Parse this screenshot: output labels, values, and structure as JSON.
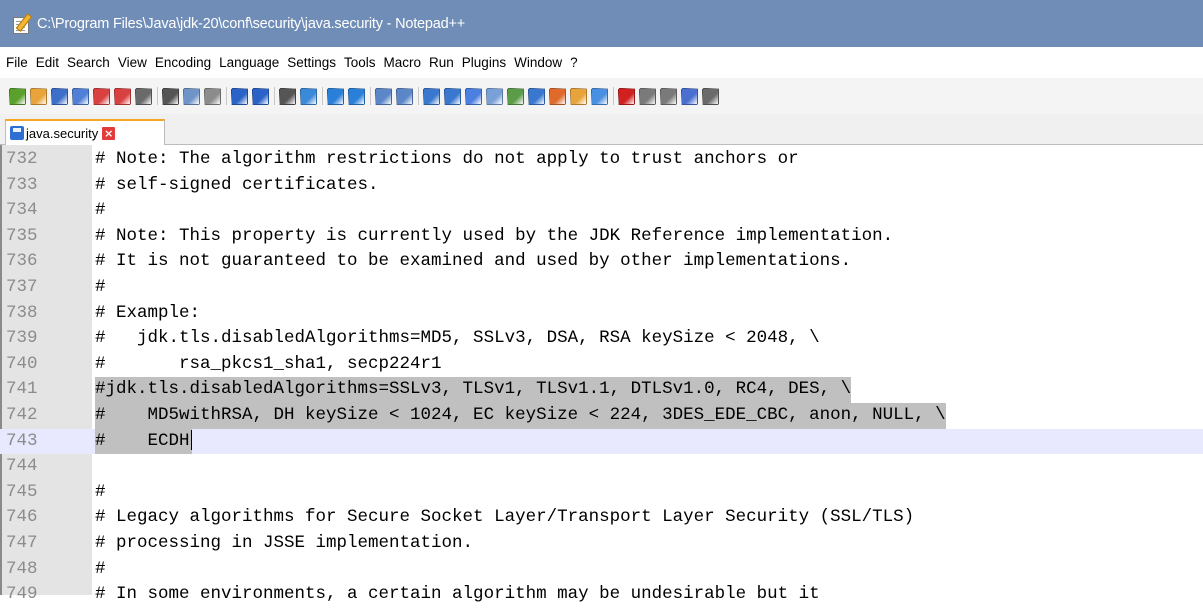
{
  "window": {
    "title": "C:\\Program Files\\Java\\jdk-20\\conf\\security\\java.security - Notepad++"
  },
  "menu": [
    "File",
    "Edit",
    "Search",
    "View",
    "Encoding",
    "Language",
    "Settings",
    "Tools",
    "Macro",
    "Run",
    "Plugins",
    "Window",
    "?"
  ],
  "toolbar": {
    "buttons": [
      "new-file-icon",
      "open-file-icon",
      "save-icon",
      "save-all-icon",
      "close-icon",
      "close-all-icon",
      "print-icon",
      "cut-icon",
      "copy-icon",
      "paste-icon",
      "undo-icon",
      "redo-icon",
      "find-icon",
      "replace-icon",
      "zoom-in-icon",
      "zoom-out-icon",
      "sync-vertical-icon",
      "sync-horizontal-icon",
      "word-wrap-icon",
      "show-all-chars-icon",
      "indent-guide-icon",
      "udl-icon",
      "doc-map-icon",
      "doc-list-icon",
      "function-list-icon",
      "folder-workspace-icon",
      "monitoring-icon",
      "record-macro-icon",
      "stop-macro-icon",
      "play-macro-icon",
      "run-macro-multiple-icon",
      "save-macro-icon"
    ]
  },
  "tab": {
    "label": "java.security"
  },
  "editor": {
    "lines": [
      {
        "num": "732",
        "text": "# Note: The algorithm restrictions do not apply to trust anchors or"
      },
      {
        "num": "733",
        "text": "# self-signed certificates."
      },
      {
        "num": "734",
        "text": "#"
      },
      {
        "num": "735",
        "text": "# Note: This property is currently used by the JDK Reference implementation."
      },
      {
        "num": "736",
        "text": "# It is not guaranteed to be examined and used by other implementations."
      },
      {
        "num": "737",
        "text": "#"
      },
      {
        "num": "738",
        "text": "# Example:"
      },
      {
        "num": "739",
        "text": "#   jdk.tls.disabledAlgorithms=MD5, SSLv3, DSA, RSA keySize < 2048, \\"
      },
      {
        "num": "740",
        "text": "#       rsa_pkcs1_sha1, secp224r1"
      },
      {
        "num": "741",
        "text": "#jdk.tls.disabledAlgorithms=SSLv3, TLSv1, TLSv1.1, DTLSv1.0, RC4, DES, \\"
      },
      {
        "num": "742",
        "text": "#    MD5withRSA, DH keySize < 1024, EC keySize < 224, 3DES_EDE_CBC, anon, NULL, \\"
      },
      {
        "num": "743",
        "text": "#    ECDH"
      },
      {
        "num": "744",
        "text": ""
      },
      {
        "num": "745",
        "text": "#"
      },
      {
        "num": "746",
        "text": "# Legacy algorithms for Secure Socket Layer/Transport Layer Security (SSL/TLS)"
      },
      {
        "num": "747",
        "text": "# processing in JSSE implementation."
      },
      {
        "num": "748",
        "text": "#"
      },
      {
        "num": "749",
        "text": "# In some environments, a certain algorithm may be undesirable but it"
      }
    ]
  },
  "colors": {
    "titlebar": "#6f8db6",
    "selection": "#c0c0c0",
    "current_line": "#e8e8ff",
    "gutter": "#e4e4e4"
  }
}
